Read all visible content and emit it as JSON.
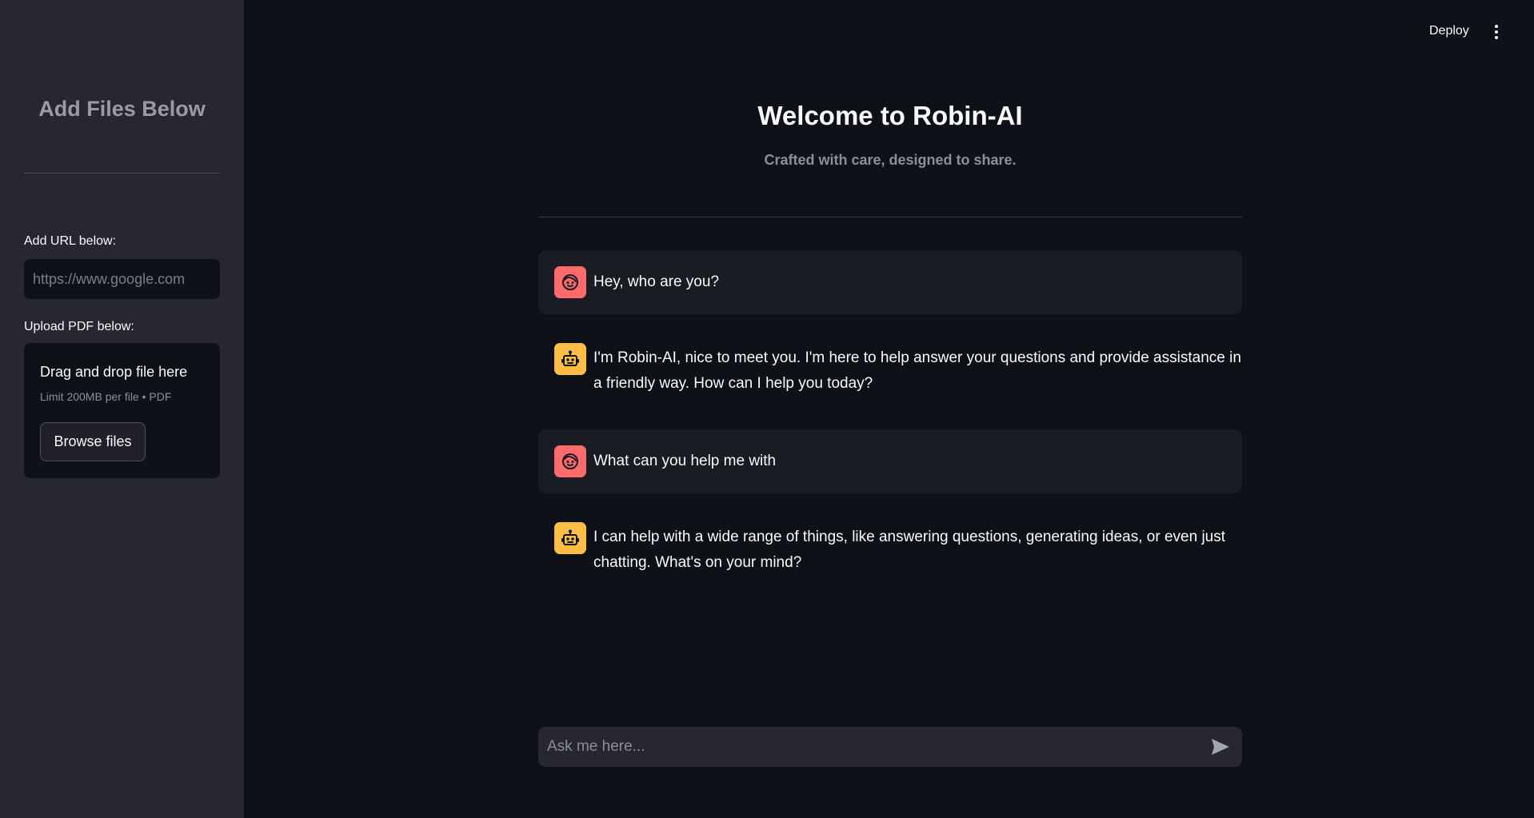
{
  "sidebar": {
    "title": "Add Files Below",
    "url_label": "Add URL below:",
    "url_placeholder": "https://www.google.com",
    "pdf_label": "Upload PDF below:",
    "dropzone_title": "Drag and drop file here",
    "dropzone_limit": "Limit 200MB per file • PDF",
    "browse_label": "Browse files"
  },
  "header": {
    "deploy_label": "Deploy",
    "menu_icon": "kebab-menu-icon"
  },
  "main": {
    "title": "Welcome to Robin-AI",
    "subtitle": "Crafted with care, designed to share."
  },
  "messages": [
    {
      "role": "user",
      "text": "Hey, who are you?",
      "avatar_icon": "user-face-icon",
      "avatar_color": "#ff6b6b"
    },
    {
      "role": "assistant",
      "text": "I'm Robin-AI, nice to meet you. I'm here to help answer your questions and provide assistance in a friendly way. How can I help you today?",
      "avatar_icon": "robot-icon",
      "avatar_color": "#ffbd45"
    },
    {
      "role": "user",
      "text": "What can you help me with",
      "avatar_icon": "user-face-icon",
      "avatar_color": "#ff6b6b"
    },
    {
      "role": "assistant",
      "text": "I can help with a wide range of things, like answering questions, generating ideas, or even just chatting. What's on your mind?",
      "avatar_icon": "robot-icon",
      "avatar_color": "#ffbd45"
    }
  ],
  "chat_input": {
    "placeholder": "Ask me here...",
    "send_icon": "send-icon"
  },
  "colors": {
    "background": "#0e1117",
    "sidebar": "#262730",
    "user_avatar": "#ff6b6b",
    "assistant_avatar": "#ffbd45"
  }
}
